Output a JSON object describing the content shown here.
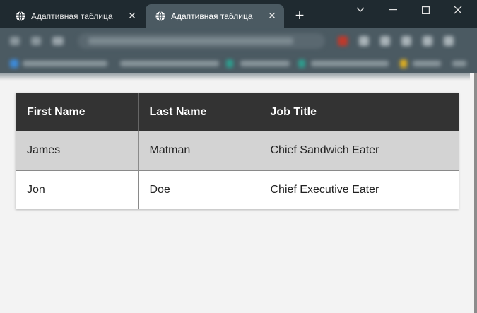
{
  "browser": {
    "tabs": [
      {
        "title": "Адаптивная таблица",
        "active": false
      },
      {
        "title": "Адаптивная таблица",
        "active": true
      }
    ],
    "new_tab_symbol": "+",
    "close_symbol": "✕",
    "window_controls": {
      "dropdown": "chevron-down-icon",
      "minimize": "minimize-icon",
      "maximize": "maximize-icon",
      "close": "close-icon"
    }
  },
  "colors": {
    "titlebar": "#1f2a30",
    "toolbar": "#4b5a62",
    "header_bg": "#333333",
    "odd_row_bg": "#d3d3d3",
    "even_row_bg": "#ffffff",
    "page_bg": "#f3f3f3"
  },
  "table": {
    "headers": [
      "First Name",
      "Last Name",
      "Job Title"
    ],
    "rows": [
      [
        "James",
        "Matman",
        "Chief Sandwich Eater"
      ],
      [
        "Jon",
        "Doe",
        "Chief Executive Eater"
      ]
    ]
  }
}
